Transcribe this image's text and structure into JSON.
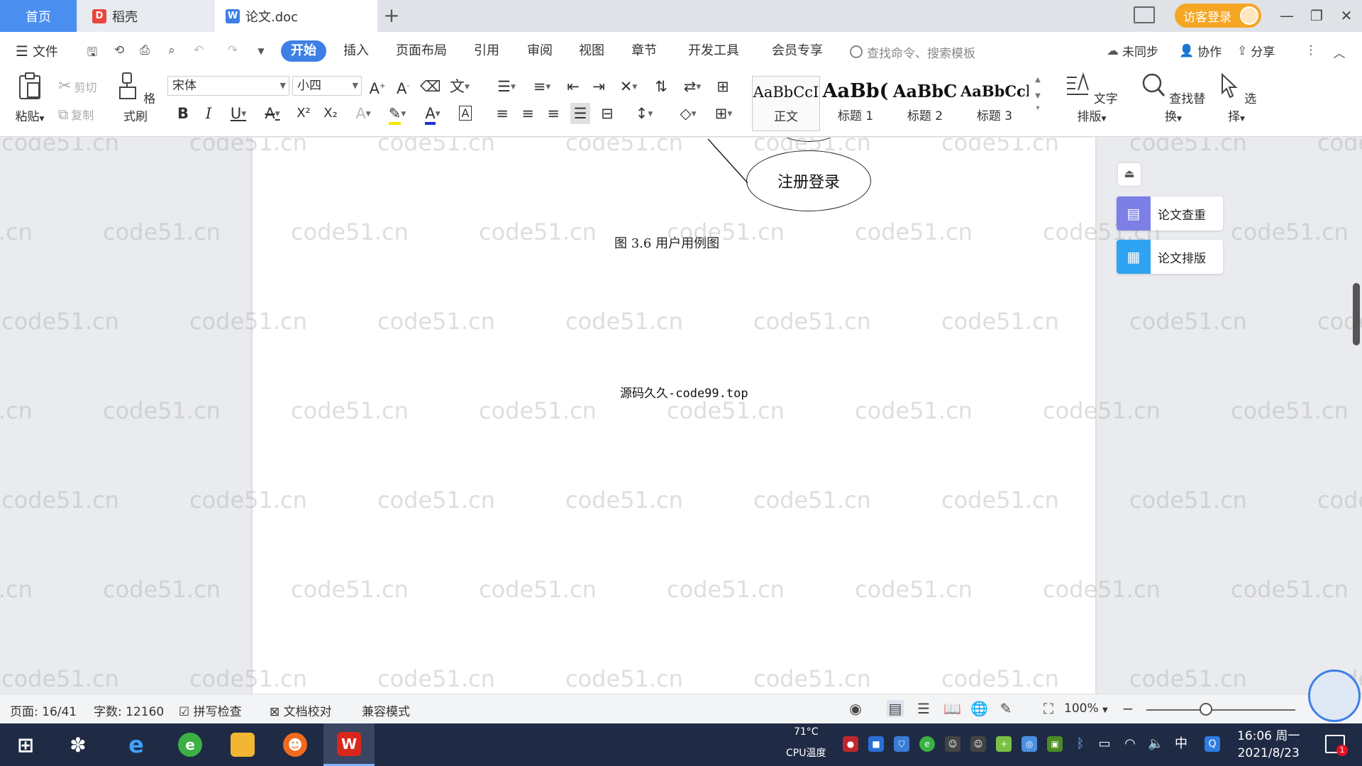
{
  "tabs": [
    {
      "label": "首页",
      "active": false
    },
    {
      "label": "稻壳",
      "icon": "daoke-logo-icon"
    },
    {
      "label": "论文.doc",
      "icon": "wps-writer-icon",
      "active": true
    }
  ],
  "titlebar": {
    "visitor_login": "访客登录"
  },
  "menu": {
    "file": "文件",
    "items": [
      "开始",
      "插入",
      "页面布局",
      "引用",
      "审阅",
      "视图",
      "章节",
      "开发工具",
      "会员专享"
    ],
    "active": "开始",
    "search_placeholder": "查找命令、搜索模板",
    "unsynced": "未同步",
    "collaborate": "协作",
    "share": "分享"
  },
  "ribbon": {
    "paste": "粘贴",
    "cut": "剪切",
    "copy": "复制",
    "format_painter": "格式刷",
    "font_name": "宋体",
    "font_size": "小四",
    "styles": [
      {
        "preview": "AaBbCcI",
        "name": "正文"
      },
      {
        "preview": "AaBb(",
        "name": "标题 1"
      },
      {
        "preview": "AaBbC",
        "name": "标题 2"
      },
      {
        "preview": "AaBbCcl",
        "name": "标题 3"
      }
    ],
    "text_layout": "文字排版",
    "find_replace": "查找替换",
    "select": "选择"
  },
  "document": {
    "usecase_label": "注册登录",
    "figure_caption": "图 3.6  用户用例图",
    "source_text": "源码久久-code99.top",
    "watermark": "code51.cn"
  },
  "side_panel": {
    "check": "论文查重",
    "layout": "论文排版",
    "accent_check": "#7b7fe6",
    "accent_layout": "#2ea3f2"
  },
  "status": {
    "page": "页面: 16/41",
    "words": "字数: 12160",
    "spell_check": "拼写检查",
    "proofread": "文档校对",
    "compat_mode": "兼容模式",
    "zoom": "100%",
    "zoom_fraction": 0.4
  },
  "taskbar": {
    "cpu_temp_value": "71°C",
    "cpu_temp_label": "CPU温度",
    "ime": "中",
    "time": "16:06 周一",
    "date": "2021/8/23",
    "notification_count": "1"
  },
  "colors": {
    "accent": "#3d7fe6",
    "visitor": "#f5a623"
  }
}
